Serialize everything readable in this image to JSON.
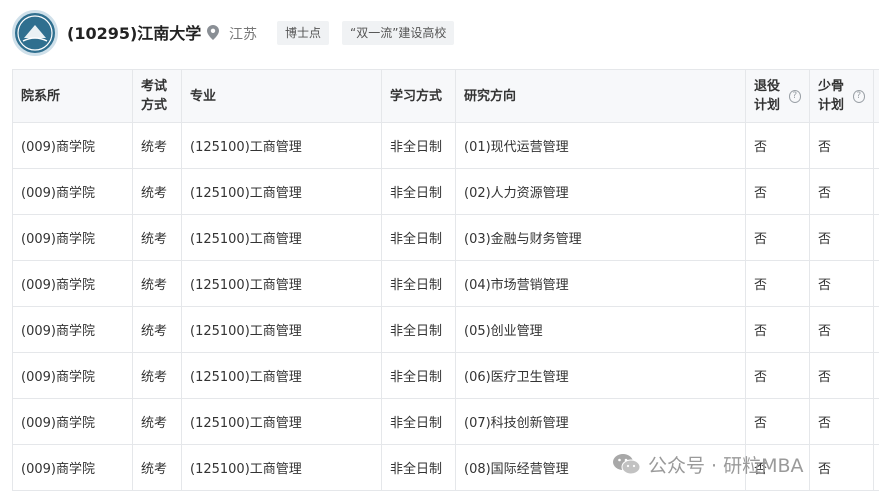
{
  "header": {
    "university_name": "(10295)江南大学",
    "province": "江苏",
    "tags": [
      "博士点",
      "“双一流”建设高校"
    ]
  },
  "table": {
    "columns": [
      "院系所",
      "考试方式",
      "专业",
      "学习方式",
      "研究方向",
      "退役计划",
      "少骨计划"
    ],
    "rows": [
      [
        "(009)商学院",
        "统考",
        "(125100)工商管理",
        "非全日制",
        "(01)现代运营管理",
        "否",
        "否"
      ],
      [
        "(009)商学院",
        "统考",
        "(125100)工商管理",
        "非全日制",
        "(02)人力资源管理",
        "否",
        "否"
      ],
      [
        "(009)商学院",
        "统考",
        "(125100)工商管理",
        "非全日制",
        "(03)金融与财务管理",
        "否",
        "否"
      ],
      [
        "(009)商学院",
        "统考",
        "(125100)工商管理",
        "非全日制",
        "(04)市场营销管理",
        "否",
        "否"
      ],
      [
        "(009)商学院",
        "统考",
        "(125100)工商管理",
        "非全日制",
        "(05)创业管理",
        "否",
        "否"
      ],
      [
        "(009)商学院",
        "统考",
        "(125100)工商管理",
        "非全日制",
        "(06)医疗卫生管理",
        "否",
        "否"
      ],
      [
        "(009)商学院",
        "统考",
        "(125100)工商管理",
        "非全日制",
        "(07)科技创新管理",
        "否",
        "否"
      ],
      [
        "(009)商学院",
        "统考",
        "(125100)工商管理",
        "非全日制",
        "(08)国际经营管理",
        "否",
        "否"
      ]
    ]
  },
  "watermark": {
    "text": "公众号 · 研粒MBA",
    "icon": "wechat-icon"
  },
  "colors": {
    "header_bg": "#f7f8fa",
    "border": "#e5e7ea",
    "tag_bg": "#f0f2f4",
    "logo": "#2f6f8f"
  }
}
